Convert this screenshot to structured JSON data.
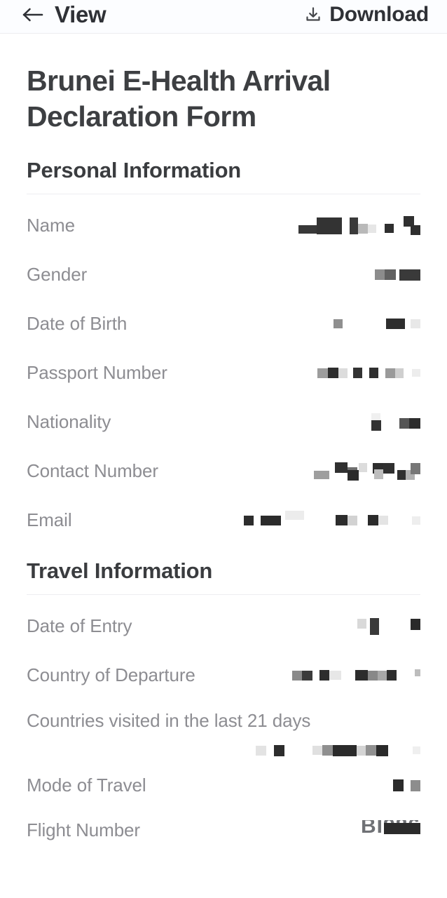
{
  "appbar": {
    "back_icon": "back-arrow-icon",
    "title": "View",
    "download_icon": "download-icon",
    "download_label": "Download"
  },
  "document": {
    "title": "Brunei E-Health Arrival Declaration Form",
    "sections": [
      {
        "heading": "Personal Information",
        "fields": [
          {
            "label": "Name",
            "value": "",
            "redacted": true
          },
          {
            "label": "Gender",
            "value": "",
            "redacted": true
          },
          {
            "label": "Date of Birth",
            "value": "",
            "redacted": true
          },
          {
            "label": "Passport Number",
            "value": "",
            "redacted": true
          },
          {
            "label": "Nationality",
            "value": "",
            "redacted": true
          },
          {
            "label": "Contact Number",
            "value": "",
            "redacted": true
          },
          {
            "label": "Email",
            "value": "",
            "redacted": true
          }
        ]
      },
      {
        "heading": "Travel Information",
        "fields": [
          {
            "label": "Date of Entry",
            "value": "",
            "redacted": true
          },
          {
            "label": "Country of Departure",
            "value": "",
            "redacted": true
          },
          {
            "label": "Countries visited in the last 21 days",
            "value": "",
            "redacted": true
          },
          {
            "label": "Mode of Travel",
            "value": "",
            "redacted": true
          },
          {
            "label": "Flight Number",
            "value": "BI986",
            "redacted": true
          }
        ]
      }
    ]
  },
  "colors": {
    "page_background": "#ffffff",
    "appbar_background": "#fcfdff",
    "heading_text": "#3a3c3f",
    "label_text": "#8d8d92",
    "divider": "#ededf1",
    "redaction": "#2b2b2b"
  }
}
